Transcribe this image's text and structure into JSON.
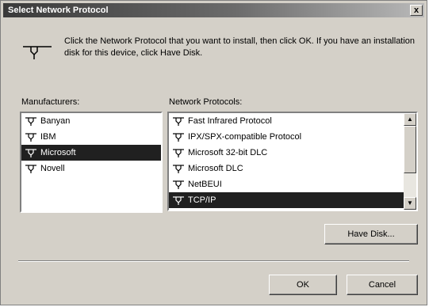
{
  "window": {
    "title": "Select Network Protocol",
    "close_glyph": "x"
  },
  "instruction": "Click the Network Protocol that you want to install, then click OK. If you have an installation disk for this device, click Have Disk.",
  "manufacturers": {
    "label": "Manufacturers:",
    "items": [
      {
        "label": "Banyan",
        "selected": false
      },
      {
        "label": "IBM",
        "selected": false
      },
      {
        "label": "Microsoft",
        "selected": true
      },
      {
        "label": "Novell",
        "selected": false
      }
    ]
  },
  "protocols": {
    "label": "Network Protocols:",
    "items": [
      {
        "label": "Fast Infrared Protocol",
        "selected": false
      },
      {
        "label": "IPX/SPX-compatible Protocol",
        "selected": false
      },
      {
        "label": "Microsoft 32-bit DLC",
        "selected": false
      },
      {
        "label": "Microsoft DLC",
        "selected": false
      },
      {
        "label": "NetBEUI",
        "selected": false
      },
      {
        "label": "TCP/IP",
        "selected": true
      }
    ]
  },
  "buttons": {
    "have_disk": "Have Disk...",
    "ok": "OK",
    "cancel": "Cancel"
  },
  "icons": {
    "instruction": "network-cable-icon",
    "protocol_item": "network-protocol-icon",
    "scroll_up": "scroll-up-arrow-icon",
    "scroll_down": "scroll-down-arrow-icon"
  },
  "colors": {
    "dialog_face": "#d4d0c8",
    "selection": "#202020",
    "titlebar_start": "#3a3a3a"
  }
}
